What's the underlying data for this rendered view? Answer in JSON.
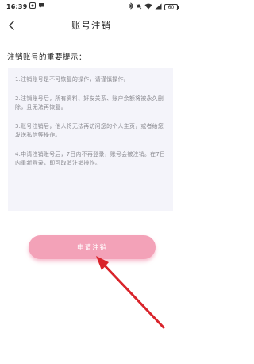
{
  "status_bar": {
    "time": "16:39",
    "battery": "60"
  },
  "header": {
    "title": "账号注销"
  },
  "notice": {
    "heading": "注销账号的重要提示：",
    "items": [
      "1.注销账号是不可恢复的操作，请谨慎操作。",
      "2.注销账号后，所有资料、好友关系、账户余额将被永久删除，且无法再恢复。",
      "3.账号注销后，他人将无法再访问您的个人主页，或者给您发送私信等操作。",
      "4.申请注销账号后，7日内不再登录，账号会被注销。在7日内重新登录，即可取消注销操作。"
    ]
  },
  "actions": {
    "apply_label": "申请注销"
  },
  "colors": {
    "button_pink": "#f3a2b8",
    "notice_bg": "#f4f4fa",
    "annotation_arrow": "#d9242b"
  },
  "icons": {
    "back": "chevron-left-icon",
    "annotation": "red-arrow-icon"
  }
}
